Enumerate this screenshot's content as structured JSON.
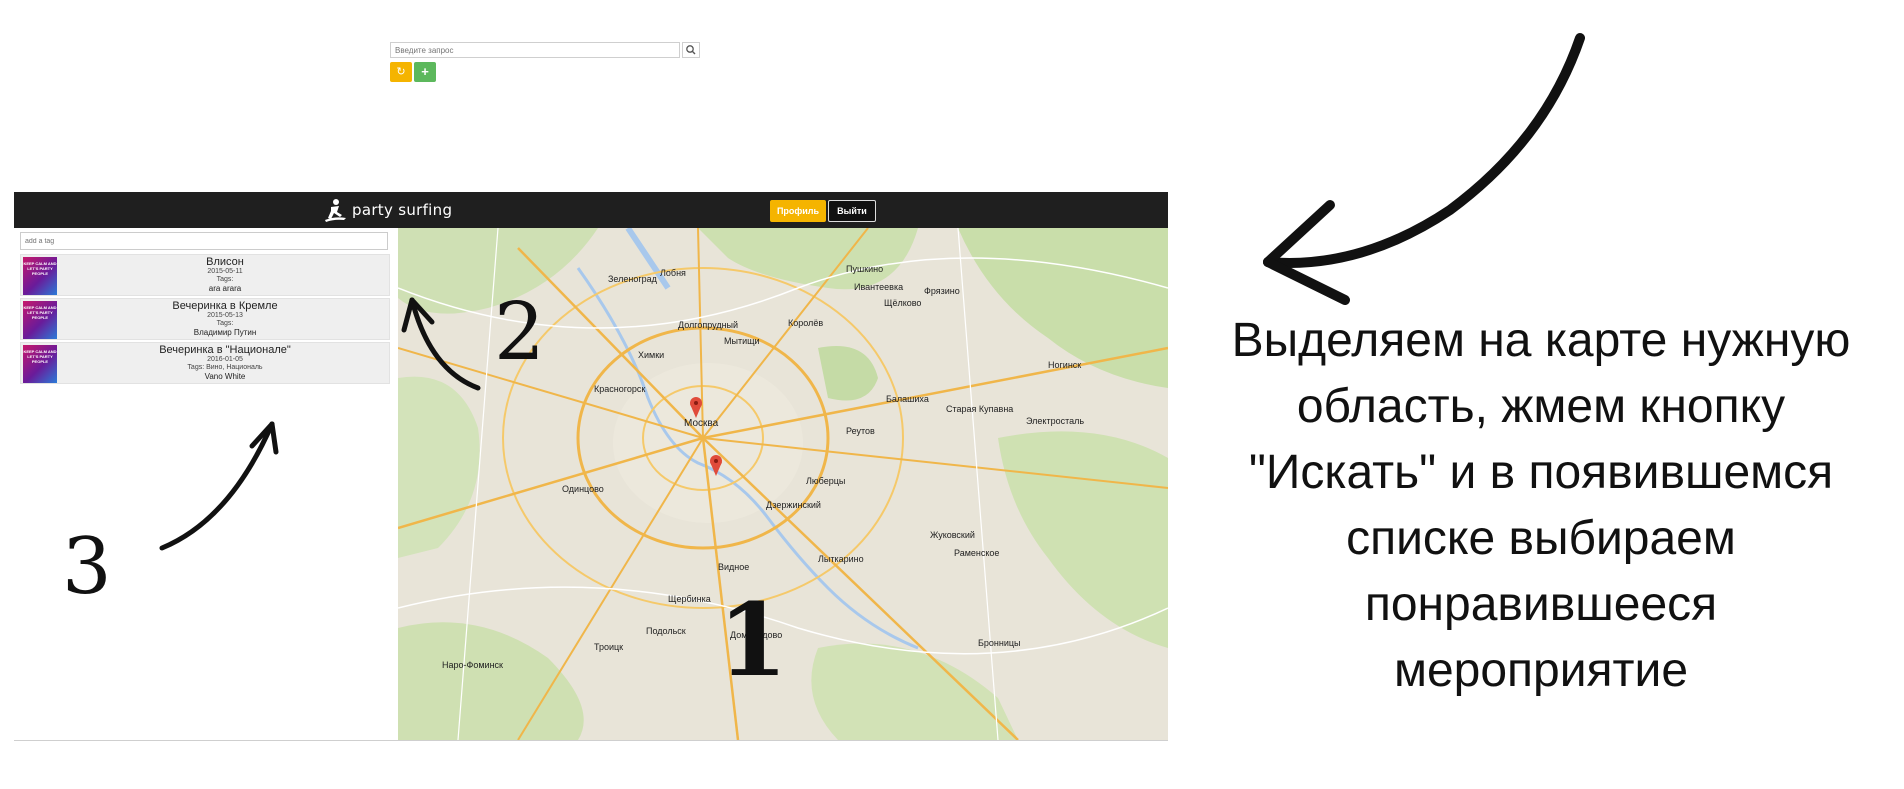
{
  "app": {
    "brand": "party surfing",
    "profile_label": "Профиль",
    "logout_label": "Выйти",
    "colors": {
      "topbar": "#1f1f1f",
      "accent_yellow": "#f5b400",
      "accent_green": "#5cb85c"
    }
  },
  "sidebar": {
    "tag_placeholder": "add a tag",
    "events": [
      {
        "title": "Влисон",
        "date": "2015-05-11",
        "tags_label": "Tags:",
        "tags": "ara arara",
        "thumb": "KEEP CALM AND LET'S PARTY PEOPLE"
      },
      {
        "title": "Вечеринка в Кремле",
        "date": "2015-05-13",
        "tags_label": "Tags:",
        "tags": "Владимир Путин",
        "thumb": "KEEP CALM AND LET'S PARTY PEOPLE"
      },
      {
        "title": "Вечеринка в \"Национале\"",
        "date": "2016-01-05",
        "tags_label": "Tags: Вино, Националь",
        "tags": "Vano White",
        "thumb": "KEEP CALM AND LET'S PARTY PEOPLE"
      }
    ]
  },
  "map": {
    "search_placeholder": "Введите запрос",
    "search_icon": "search-icon",
    "refresh_icon": "refresh-icon",
    "add_icon": "plus-icon",
    "city_labels": [
      "Москва",
      "Химки",
      "Мытищи",
      "Королёв",
      "Балашиха",
      "Люберцы",
      "Видное",
      "Домодедово",
      "Красногорск",
      "Одинцово",
      "Реутов",
      "Дзержинский",
      "Жуковский",
      "Раменское",
      "Лобня",
      "Долгопрудный",
      "Щербинка",
      "Подольск",
      "Наро-Фоминск",
      "Электросталь",
      "Ногинск",
      "Щёлково",
      "Пушкино",
      "Ивантеевка",
      "Фрязино",
      "Зеленоград",
      "Старая Купавна",
      "Лыткарино",
      "Троицк",
      "Бронницы"
    ]
  },
  "annotations": {
    "callout": [
      "Выделяем на карте нужную",
      "область, жмем кнопку",
      "\"Искать\" и в появившемся",
      "списке выбираем",
      "понравившееся",
      "мероприятие"
    ],
    "digits": [
      "1",
      "2",
      "3"
    ]
  }
}
